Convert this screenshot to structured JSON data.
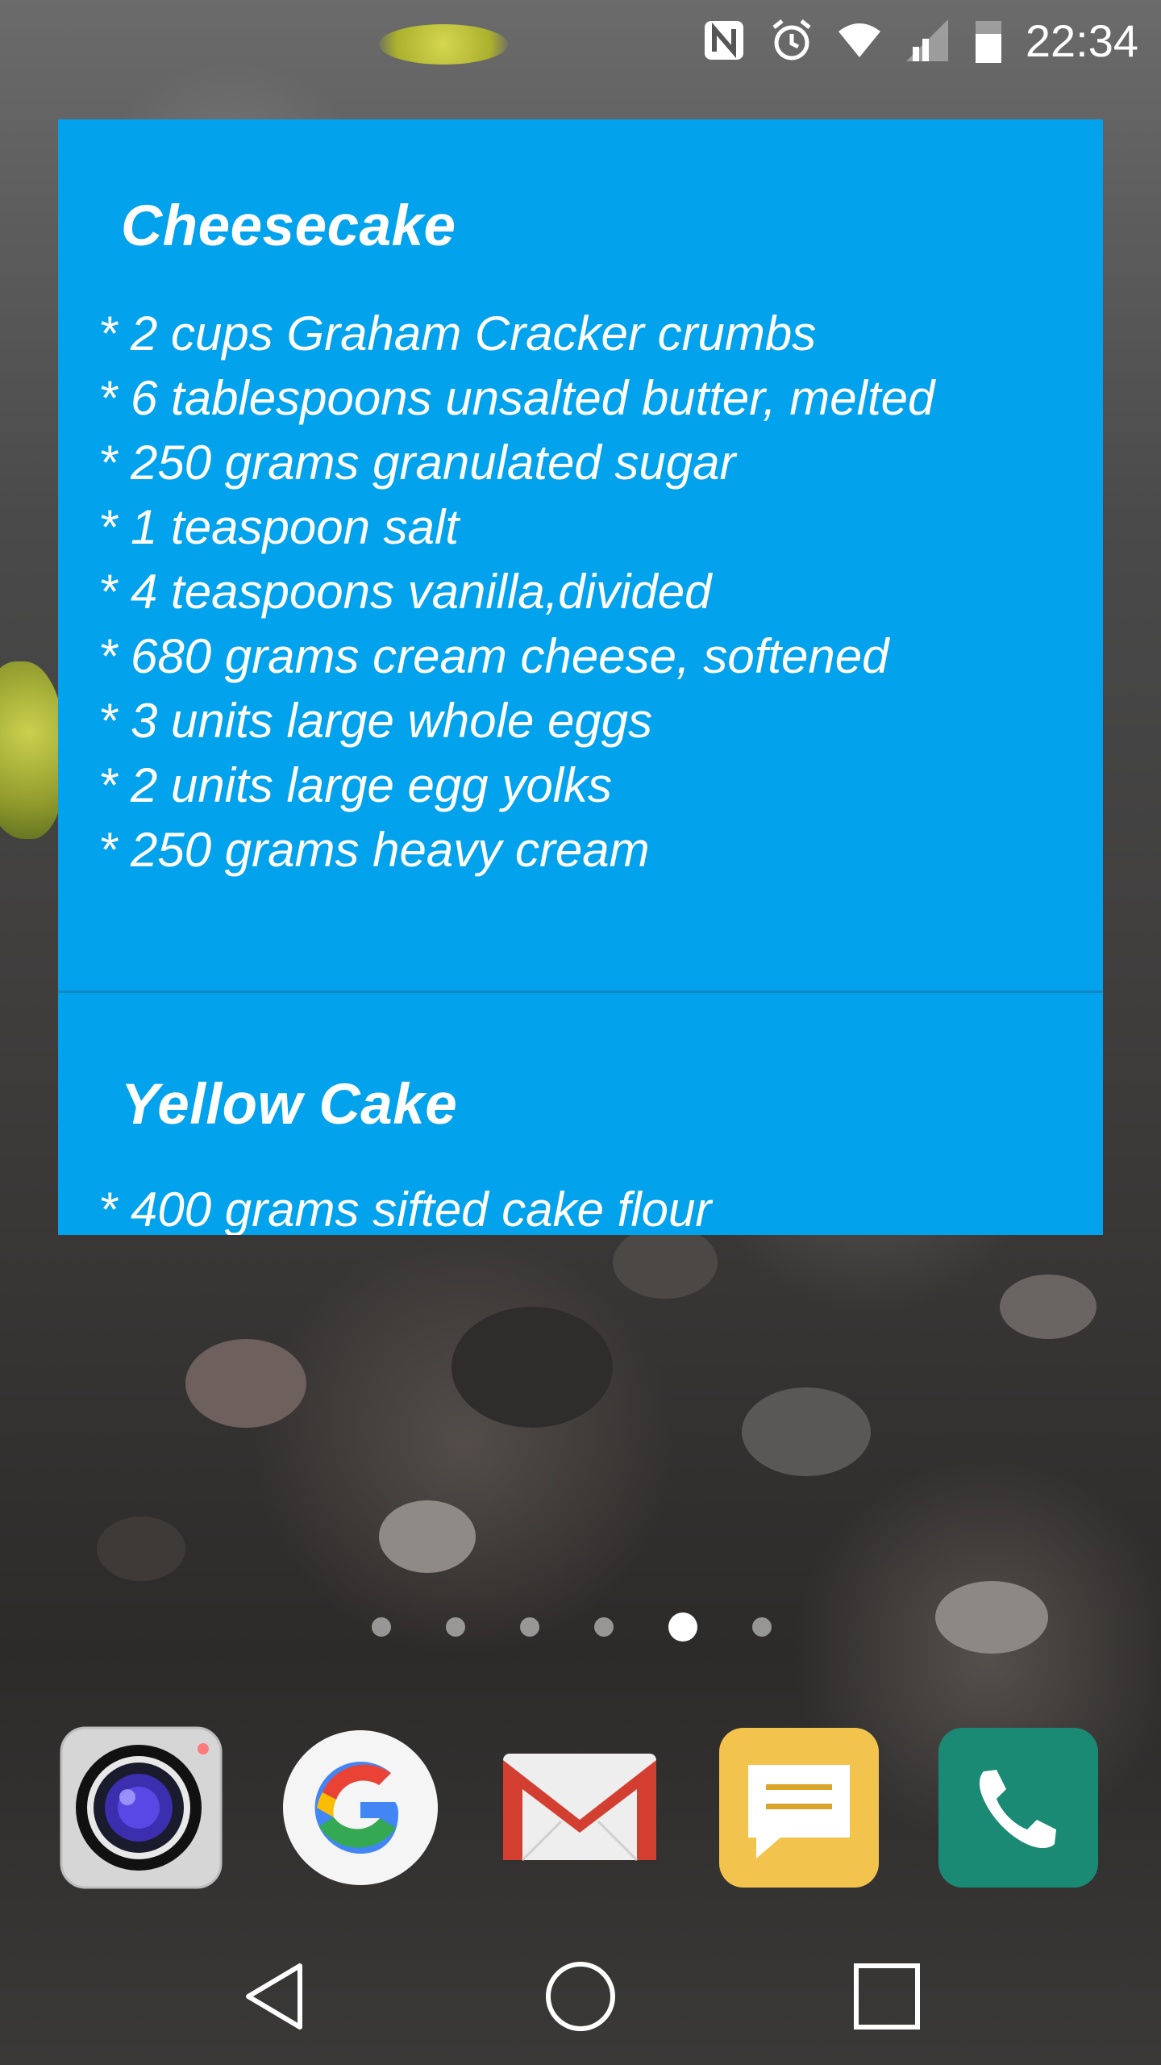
{
  "status_bar": {
    "time": "22:34",
    "icons": [
      "nfc-icon",
      "alarm-icon",
      "wifi-icon",
      "signal-icon",
      "battery-icon"
    ]
  },
  "widget": {
    "background_color": "#03a2ec",
    "recipes": [
      {
        "title": "Cheesecake",
        "ingredients": [
          "* 2 cups Graham Cracker crumbs",
          "* 6 tablespoons unsalted butter, melted",
          "* 250 grams granulated sugar",
          "* 1 teaspoon salt",
          "* 4 teaspoons vanilla,divided",
          "* 680 grams cream cheese, softened",
          "* 3 units large whole eggs",
          "* 2 units large egg yolks",
          "* 250 grams heavy cream"
        ]
      },
      {
        "title": "Yellow Cake",
        "ingredients": [
          "* 400 grams sifted cake flour"
        ]
      }
    ]
  },
  "home_pages": {
    "count": 6,
    "active_index": 4
  },
  "dock": {
    "apps": [
      "camera",
      "google",
      "gmail",
      "messages",
      "phone"
    ]
  },
  "nav_bar": {
    "buttons": [
      "back",
      "home",
      "recents"
    ]
  }
}
